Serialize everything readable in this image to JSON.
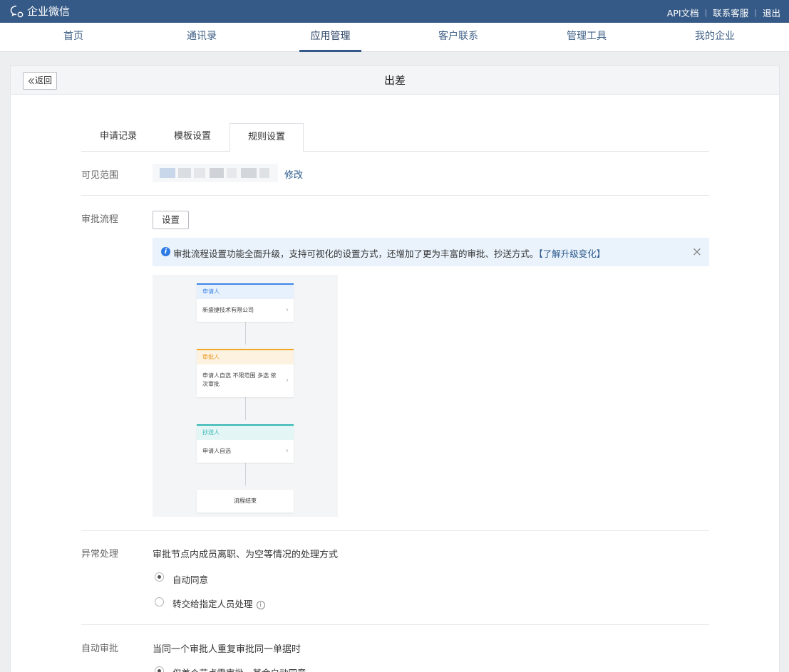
{
  "topbar": {
    "brand": "企业微信",
    "links": [
      "API文档",
      "联系客服",
      "退出"
    ],
    "bg": "#365a87"
  },
  "nav": {
    "items": [
      "首页",
      "通讯录",
      "应用管理",
      "客户联系",
      "管理工具",
      "我的企业"
    ],
    "active_index": 2
  },
  "page": {
    "back_label": "返回",
    "title": "出差"
  },
  "tabs": {
    "items": [
      "申请记录",
      "模板设置",
      "规则设置"
    ],
    "active_index": 2
  },
  "visibility": {
    "label": "可见范围",
    "edit_link": "修改"
  },
  "approval_flow": {
    "label": "审批流程",
    "set_button": "设置",
    "notice_text": "审批流程设置功能全面升级，支持可视化的设置方式，还增加了更为丰富的审批、抄送方式。",
    "notice_link": "【了解升级变化】",
    "close_icon": "×",
    "preview": {
      "applicant_header": "申请人",
      "applicant_body": "新盛捷技术有限公司",
      "approver_header": "审批人",
      "approver_body": "申请人自选 不限范围 多选 依次审批",
      "cc_header": "抄送人",
      "cc_body": "申请人自选",
      "end_label": "流程结束",
      "colors": {
        "applicant": "#3e86e8",
        "approver": "#f5a623",
        "cc": "#2fb5b3"
      }
    }
  },
  "exception": {
    "label": "异常处理",
    "desc": "审批节点内成员离职、为空等情况的处理方式",
    "options": [
      "自动同意",
      "转交给指定人员处理"
    ],
    "selected_index": 0
  },
  "auto_approve": {
    "label": "自动审批",
    "desc": "当同一个审批人重复审批同一单据时",
    "options": [
      "仅首个节点需审批，其余自动同意"
    ],
    "selected_index": 0
  }
}
